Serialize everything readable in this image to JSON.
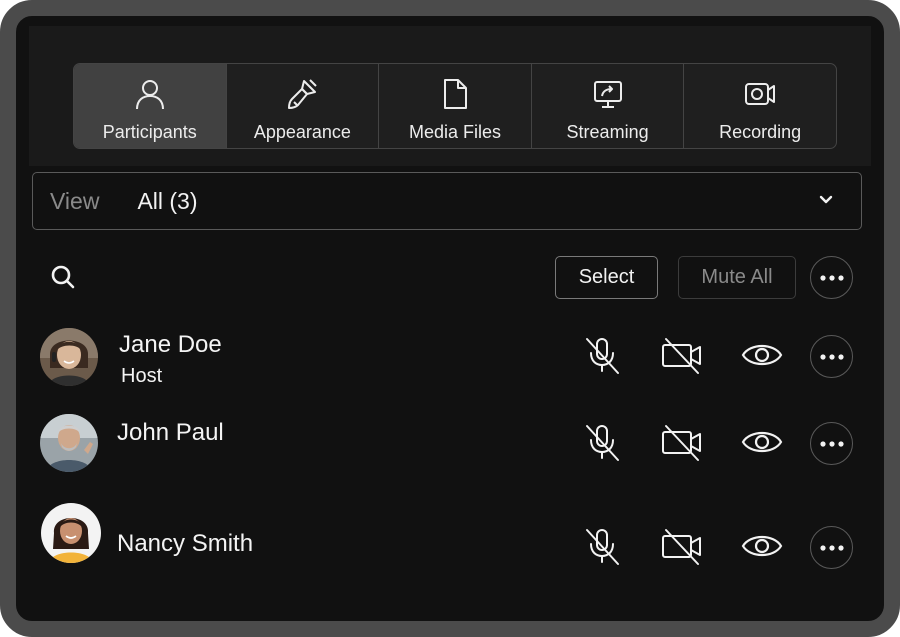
{
  "tabs": [
    {
      "label": "Participants",
      "icon": "person-icon",
      "active": true
    },
    {
      "label": "Appearance",
      "icon": "paintbrush-icon",
      "active": false
    },
    {
      "label": "Media Files",
      "icon": "file-icon",
      "active": false
    },
    {
      "label": "Streaming",
      "icon": "screen-share-icon",
      "active": false
    },
    {
      "label": "Recording",
      "icon": "camera-icon",
      "active": false
    }
  ],
  "view": {
    "label": "View",
    "value": "All (3)"
  },
  "toolbar": {
    "select_label": "Select",
    "mute_all_label": "Mute All"
  },
  "participants": [
    {
      "name": "Jane Doe",
      "role": "Host"
    },
    {
      "name": "John Paul",
      "role": ""
    },
    {
      "name": "Nancy Smith",
      "role": ""
    }
  ],
  "colors": {
    "background": "#111111",
    "frame": "#4b4b4b",
    "active_tab": "#414141",
    "text": "#f4f4f4"
  }
}
